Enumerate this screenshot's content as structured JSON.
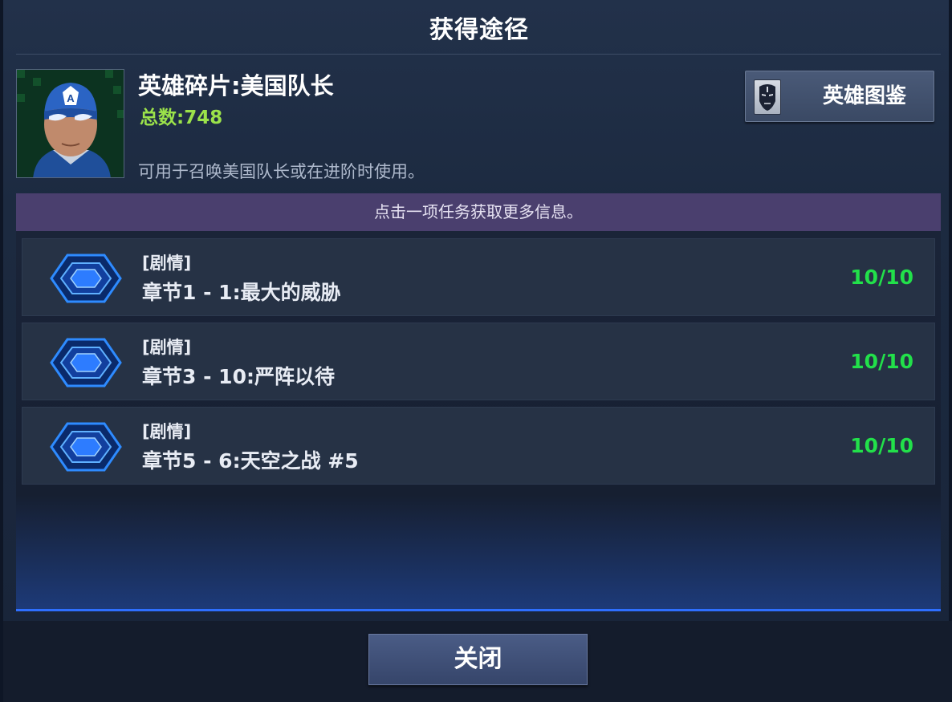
{
  "dialog": {
    "title": "获得途径"
  },
  "hero": {
    "name": "英雄碎片:美国队长",
    "total": "总数:748",
    "description": "可用于召唤美国队长或在进阶时使用。",
    "portrait_icon": "captain-america-portrait"
  },
  "gallery_button": {
    "label": "英雄图鉴",
    "icon": "iron-man-mask-icon"
  },
  "info_bar": {
    "text": "点击一项任务获取更多信息。"
  },
  "missions": [
    {
      "category": "[剧情]",
      "name": "章节1 - 1:最大的威胁",
      "progress": "10/10",
      "icon": "hexagon-mission-icon"
    },
    {
      "category": "[剧情]",
      "name": "章节3 - 10:严阵以待",
      "progress": "10/10",
      "icon": "hexagon-mission-icon"
    },
    {
      "category": "[剧情]",
      "name": "章节5 - 6:天空之战 #5",
      "progress": "10/10",
      "icon": "hexagon-mission-icon"
    }
  ],
  "footer": {
    "close_label": "关闭"
  },
  "colors": {
    "progress_green": "#22e04a",
    "total_green": "#9be24a",
    "info_bar_purple": "#4a3f6e",
    "accent_blue": "#2e6fff"
  }
}
